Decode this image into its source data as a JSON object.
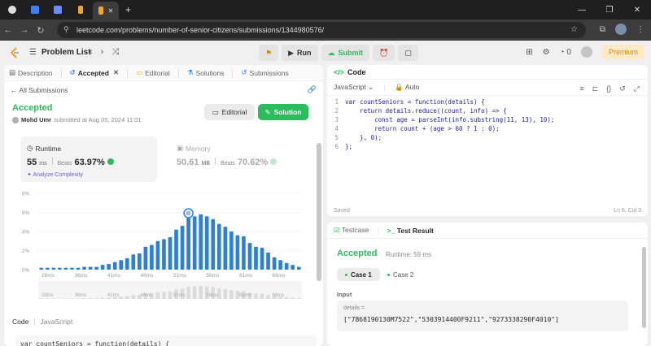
{
  "browser": {
    "url": "leetcode.com/problems/number-of-senior-citizens/submissions/1344980576/"
  },
  "topbar": {
    "problem_list": "Problem List",
    "run": "Run",
    "submit": "Submit",
    "streak": "0",
    "premium": "Premium"
  },
  "left_tabs": [
    {
      "label": "Description"
    },
    {
      "label": "Accepted"
    },
    {
      "label": "Editorial"
    },
    {
      "label": "Solutions"
    },
    {
      "label": "Submissions"
    }
  ],
  "submission": {
    "back_label": "All Submissions",
    "status": "Accepted",
    "author": "Mohd Umr",
    "submitted_text": "submitted at Aug 05, 2024 11:01",
    "editorial_btn": "Editorial",
    "solution_btn": "Solution",
    "runtime_label": "Runtime",
    "runtime_value": "55",
    "runtime_unit": "ms",
    "beats_label": "Beats",
    "runtime_beats": "63.97%",
    "analyze": "Analyze Complexity",
    "memory_label": "Memory",
    "memory_value": "50.61",
    "memory_unit": "MB",
    "memory_beats": "70.62%",
    "code_label": "Code",
    "code_lang": "JavaScript",
    "code_preview": "var countSeniors = function(details) {"
  },
  "chart_data": {
    "type": "bar",
    "ylim": [
      0,
      8
    ],
    "yticks": [
      "0%",
      "2%",
      "4%",
      "6%",
      "8%"
    ],
    "xticks": [
      "28ms",
      "36ms",
      "41ms",
      "46ms",
      "51ms",
      "56ms",
      "61ms",
      "66ms"
    ],
    "values": [
      0.2,
      0.2,
      0.2,
      0.2,
      0.2,
      0.2,
      0.2,
      0.3,
      0.3,
      0.3,
      0.5,
      0.6,
      0.8,
      1.0,
      1.2,
      1.6,
      1.7,
      2.4,
      2.6,
      3.0,
      3.2,
      3.4,
      4.2,
      4.6,
      5.4,
      5.6,
      5.8,
      5.6,
      5.3,
      4.8,
      4.5,
      4.0,
      3.6,
      3.5,
      2.8,
      2.4,
      2.3,
      1.8,
      1.3,
      1.0,
      0.7,
      0.5,
      0.3
    ],
    "highlight_index": 24
  },
  "editor": {
    "header": "Code",
    "language": "JavaScript",
    "mode": "Auto",
    "lines": [
      "var countSeniors = function(details) {",
      "    return details.reduce((count, info) => {",
      "        const age = parseInt(info.substring(11, 13), 10);",
      "        return count + (age > 60 ? 1 : 0);",
      "    }, 0);",
      "};"
    ],
    "saved": "Saved",
    "cursor": "Ln 6, Col 3"
  },
  "result": {
    "tab_testcase": "Testcase",
    "tab_result": "Test Result",
    "status": "Accepted",
    "runtime": "Runtime: 59 ms",
    "case1": "Case 1",
    "case2": "Case 2",
    "input_label": "Input",
    "var_name": "details =",
    "var_value": "[\"7868190130M7522\",\"5303914400F9211\",\"9273338290F4010\"]"
  }
}
